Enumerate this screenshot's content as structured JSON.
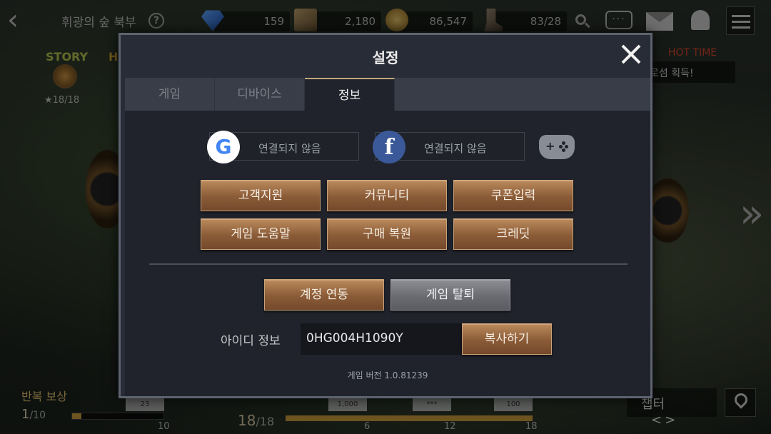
{
  "topbar": {
    "back_icon": "chevron-left",
    "area_title": "휘광의 숲 북부",
    "help_symbol": "?",
    "resources": [
      {
        "name": "gem",
        "value": "159"
      },
      {
        "name": "material-box",
        "value": "2,180"
      },
      {
        "name": "gold-coin",
        "value": "86,547"
      },
      {
        "name": "stamina-boot",
        "value": "83/28"
      }
    ],
    "chat_symbol": "···"
  },
  "hud": {
    "story_label": "STORY",
    "h_label": "H",
    "story_stars": "★18/18",
    "hot_time_label": "HOT TIME",
    "quest_text": "로섬 획득!",
    "repeat_reward_label": "반복 보상",
    "repeat_count": "1",
    "repeat_total": "/10",
    "repeat_tick": "10",
    "repeat_progress": 0.1,
    "stage_count": "18",
    "stage_total": "/18",
    "stage_progress": 1.0,
    "stage_ticks": [
      "6",
      "12",
      "18"
    ],
    "reward_chips": [
      "23",
      "1,000",
      "***",
      "100"
    ],
    "chapter_label": "챕터",
    "chapter_arrows": "<>"
  },
  "dialog": {
    "title": "설정",
    "tabs": [
      {
        "label": "게임",
        "active": false
      },
      {
        "label": "디바이스",
        "active": false
      },
      {
        "label": "정보",
        "active": true
      }
    ],
    "google": {
      "logo": "G",
      "status": "연결되지 않음"
    },
    "facebook": {
      "logo": "f",
      "status": "연결되지 않음"
    },
    "menu_buttons": [
      "고객지원",
      "커뮤니티",
      "쿠폰입력",
      "게임 도움말",
      "구매 복원",
      "크레딧"
    ],
    "account_link_label": "계정 연동",
    "quit_game_label": "게임 탈퇴",
    "id_label": "아이디 정보",
    "id_value": "0HG004H1090Y",
    "copy_label": "복사하기",
    "version_text": "게임 버전  1.0.81239"
  },
  "colors": {
    "panel_bg": "#20232b",
    "gold_button": "#8a5b37",
    "gray_button": "#6a6c72",
    "active_tab_border": "#bfa67a"
  }
}
